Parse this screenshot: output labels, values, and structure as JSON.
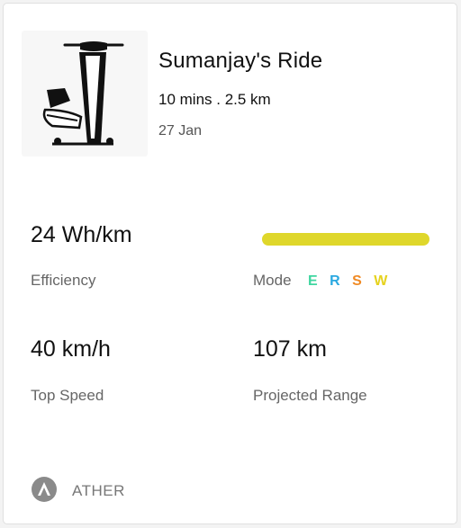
{
  "ride": {
    "title": "Sumanjay's Ride",
    "summary": "10 mins . 2.5 km",
    "date": "27 Jan"
  },
  "stats": {
    "efficiency": {
      "value": "24 Wh/km",
      "label": "Efficiency"
    },
    "mode": {
      "label": "Mode",
      "bar_color": "#dfd72b",
      "letters": [
        {
          "text": "E",
          "color": "#3fd6a0"
        },
        {
          "text": "R",
          "color": "#2aa8e0"
        },
        {
          "text": "S",
          "color": "#f08a24"
        },
        {
          "text": "W",
          "color": "#e6d21e"
        }
      ]
    },
    "top_speed": {
      "value": "40 km/h",
      "label": "Top Speed"
    },
    "range": {
      "value": "107 km",
      "label": "Projected Range"
    }
  },
  "brand": {
    "name": "ATHER",
    "icon": "ather-logo-icon"
  }
}
